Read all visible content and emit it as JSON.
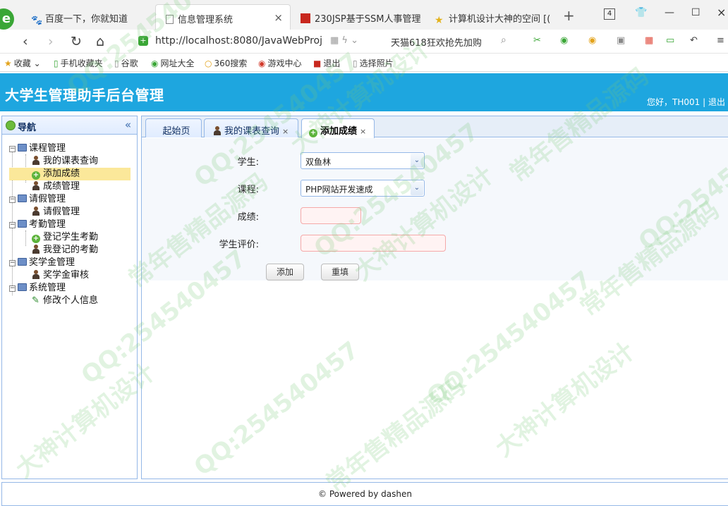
{
  "browser": {
    "tabs": [
      {
        "label": "百度一下，你就知道"
      },
      {
        "label": "信息管理系统"
      },
      {
        "label": "230JSP基于SSM人事管理"
      },
      {
        "label": "计算机设计大神的空间 [("
      }
    ],
    "tab_count": "4",
    "url": "http://localhost:8080/JavaWebProj",
    "promo": "天猫618狂欢抢先加购",
    "bookmarks": [
      {
        "label": "收藏"
      },
      {
        "label": "手机收藏夹"
      },
      {
        "label": "谷歌"
      },
      {
        "label": "网址大全"
      },
      {
        "label": "360搜索"
      },
      {
        "label": "游戏中心"
      },
      {
        "label": "退出"
      },
      {
        "label": "选择照片"
      }
    ]
  },
  "app": {
    "title": "大学生管理助手后台管理",
    "greeting": "您好，TH001",
    "sep": "|",
    "logout": "退出"
  },
  "nav": {
    "title": "导航",
    "collapse": "«",
    "groups": [
      {
        "label": "课程管理",
        "items": [
          "我的课表查询",
          "添加成绩",
          "成绩管理"
        ]
      },
      {
        "label": "请假管理",
        "items": [
          "请假管理"
        ]
      },
      {
        "label": "考勤管理",
        "items": [
          "登记学生考勤",
          "我登记的考勤"
        ]
      },
      {
        "label": "奖学金管理",
        "items": [
          "奖学金审核"
        ]
      },
      {
        "label": "系统管理",
        "items": [
          "修改个人信息"
        ]
      }
    ]
  },
  "main": {
    "tabs": [
      {
        "label": "起始页"
      },
      {
        "label": "我的课表查询",
        "close": "×"
      },
      {
        "label": "添加成绩",
        "close": "×"
      }
    ],
    "form": {
      "student_label": "学生:",
      "student_value": "双鱼林",
      "course_label": "课程:",
      "course_value": "PHP网站开发速成",
      "score_label": "成绩:",
      "comment_label": "学生评价:",
      "add_button": "添加",
      "reset_button": "重填"
    }
  },
  "footer": {
    "text": "© Powered by dashen"
  },
  "watermark": {
    "qq": "QQ:254540457",
    "t1": "常年售精品源码",
    "t2": "大神计算机设计"
  }
}
